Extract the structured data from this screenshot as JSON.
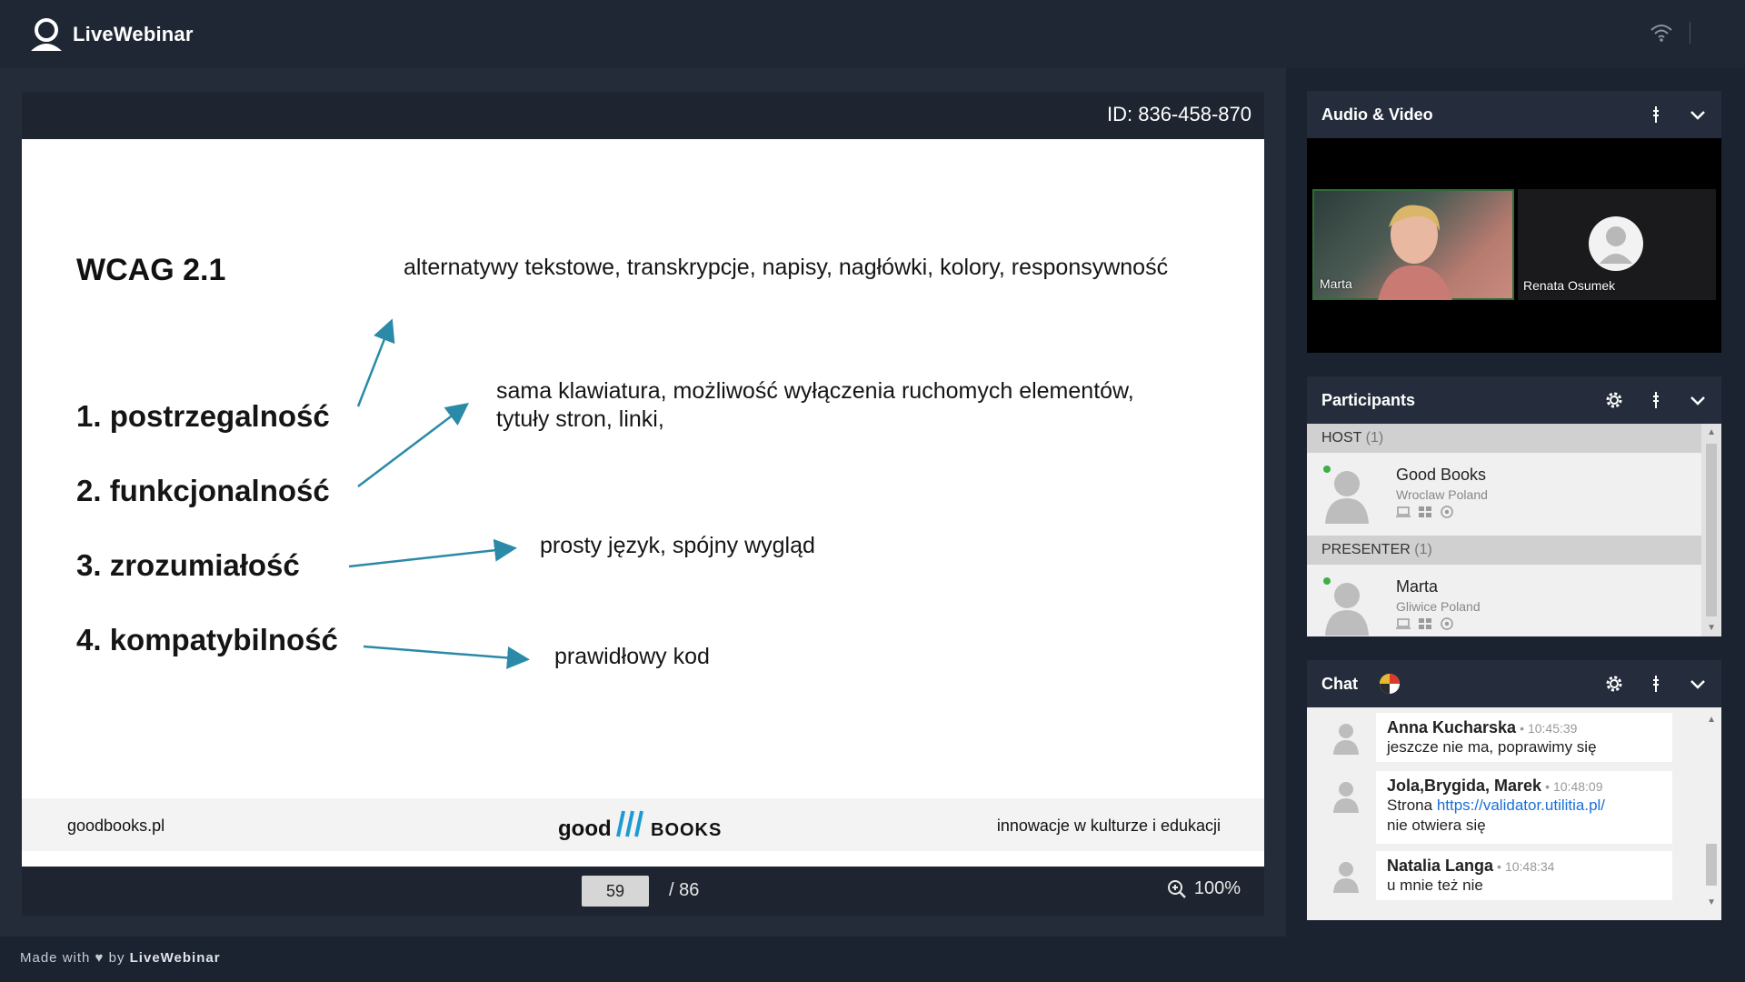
{
  "app": {
    "name": "LiveWebinar"
  },
  "presentation": {
    "meeting_id": "ID: 836-458-870",
    "slide": {
      "title": "WCAG 2.1",
      "principles": [
        "1. postrzegalność",
        "2. funkcjonalność",
        "3. zrozumiałość",
        "4. kompatybilność"
      ],
      "texts": {
        "perceivable": "alternatywy tekstowe, transkrypcje, napisy, nagłówki, kolory, responsywność",
        "operable_line1": "sama klawiatura, możliwość wyłączenia ruchomych elementów,",
        "operable_line2": "tytuły stron, linki,",
        "understandable": "prosty język, spójny wygląd",
        "robust": "prawidłowy kod"
      },
      "footer": {
        "left": "goodbooks.pl",
        "logo_left": "good",
        "logo_right": "books",
        "right": "innowacje w kulturze i edukacji"
      }
    },
    "controls": {
      "page": "59",
      "total": "/ 86",
      "zoom": "100%",
      "zoom_icon": "zoom-in-icon"
    }
  },
  "audio_video": {
    "title": "Audio & Video",
    "tiles": [
      {
        "name": "Marta"
      },
      {
        "name": "Renata Osumek"
      }
    ]
  },
  "participants": {
    "title": "Participants",
    "groups": [
      {
        "label": "HOST",
        "count": "(1)",
        "person": {
          "name": "Good Books",
          "location": "Wroclaw Poland"
        }
      },
      {
        "label": "PRESENTER",
        "count": "(1)",
        "person": {
          "name": "Marta",
          "location": "Gliwice Poland"
        }
      }
    ]
  },
  "chat": {
    "title": "Chat",
    "messages": [
      {
        "author": "Anna Kucharska",
        "time": "10:45:39",
        "text": "jeszcze nie ma, poprawimy się"
      },
      {
        "author": "Jola,Brygida, Marek",
        "time": "10:48:09",
        "prefix": "Strona",
        "link": "https://validator.utilitia.pl/",
        "text": "nie otwiera się"
      },
      {
        "author": "Natalia Langa",
        "time": "10:48:34",
        "text": "u mnie też nie"
      }
    ]
  },
  "footer": {
    "made_with": "Made with",
    "by": "by",
    "brand": "LiveWebinar"
  },
  "colors": {
    "accent_arrow": "#2a8aa8",
    "online": "#3cb043",
    "link": "#1a6fd6"
  }
}
